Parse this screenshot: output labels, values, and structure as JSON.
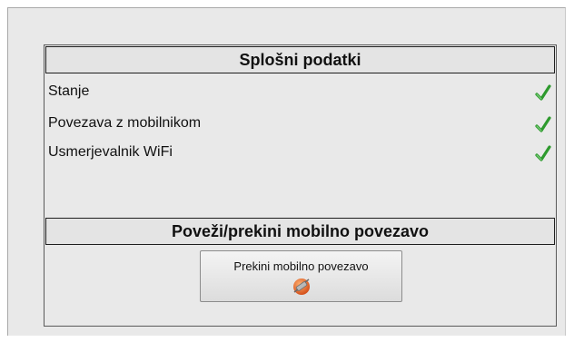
{
  "general": {
    "title": "Splošni podatki",
    "rows": [
      {
        "label": "Stanje",
        "status_icon": "check-icon",
        "status": "ok"
      },
      {
        "label": "Povezava z mobilnikom",
        "status_icon": "check-icon",
        "status": "ok"
      },
      {
        "label": "Usmerjevalnik WiFi",
        "status_icon": "check-icon",
        "status": "ok"
      }
    ]
  },
  "mobile": {
    "title": "Poveži/prekini mobilno povezavo",
    "button_label": "Prekini mobilno povezavo",
    "button_icon": "disconnect-plug-icon"
  },
  "colors": {
    "check": "#2e9a2e",
    "panel_bg": "#e9e9e9",
    "button_icon_accent": "#e8641e"
  }
}
